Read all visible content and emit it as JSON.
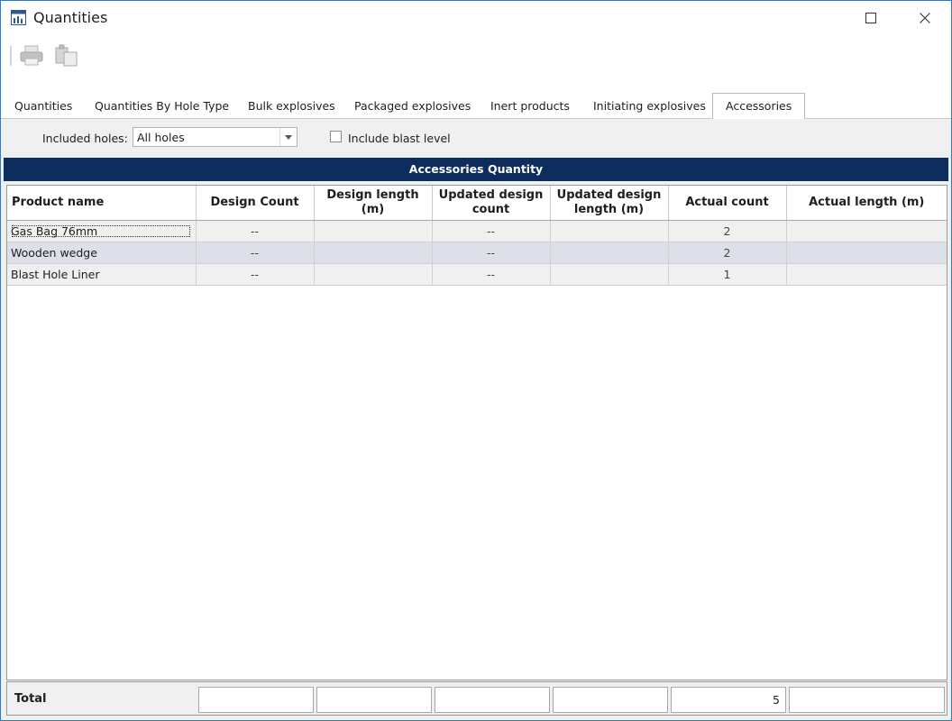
{
  "window": {
    "title": "Quantities"
  },
  "tabs": [
    {
      "label": "Quantities"
    },
    {
      "label": "Quantities By Hole Type"
    },
    {
      "label": "Bulk explosives"
    },
    {
      "label": "Packaged explosives"
    },
    {
      "label": "Inert products"
    },
    {
      "label": "Initiating explosives"
    },
    {
      "label": "Accessories",
      "active": true
    }
  ],
  "filters": {
    "included_holes_label": "Included holes:",
    "included_holes_value": "All holes",
    "include_blast_label": "Include blast level",
    "include_blast_checked": false
  },
  "grid": {
    "title": "Accessories Quantity",
    "columns": [
      "Product name",
      "Design Count",
      "Design length (m)",
      "Updated design count",
      "Updated design length (m)",
      "Actual count",
      "Actual length (m)"
    ],
    "rows": [
      [
        "Gas Bag 76mm",
        "--",
        "",
        "--",
        "",
        "2",
        ""
      ],
      [
        "Wooden wedge",
        "--",
        "",
        "--",
        "",
        "2",
        ""
      ],
      [
        "Blast Hole Liner",
        "--",
        "",
        "--",
        "",
        "1",
        ""
      ]
    ],
    "total_label": "Total",
    "totals": [
      "",
      "",
      "",
      "",
      "5",
      ""
    ]
  },
  "colors": {
    "header_bar": "#0c2d5e",
    "alt_row": "#dde0e9",
    "window_border": "#2b7bd6"
  }
}
